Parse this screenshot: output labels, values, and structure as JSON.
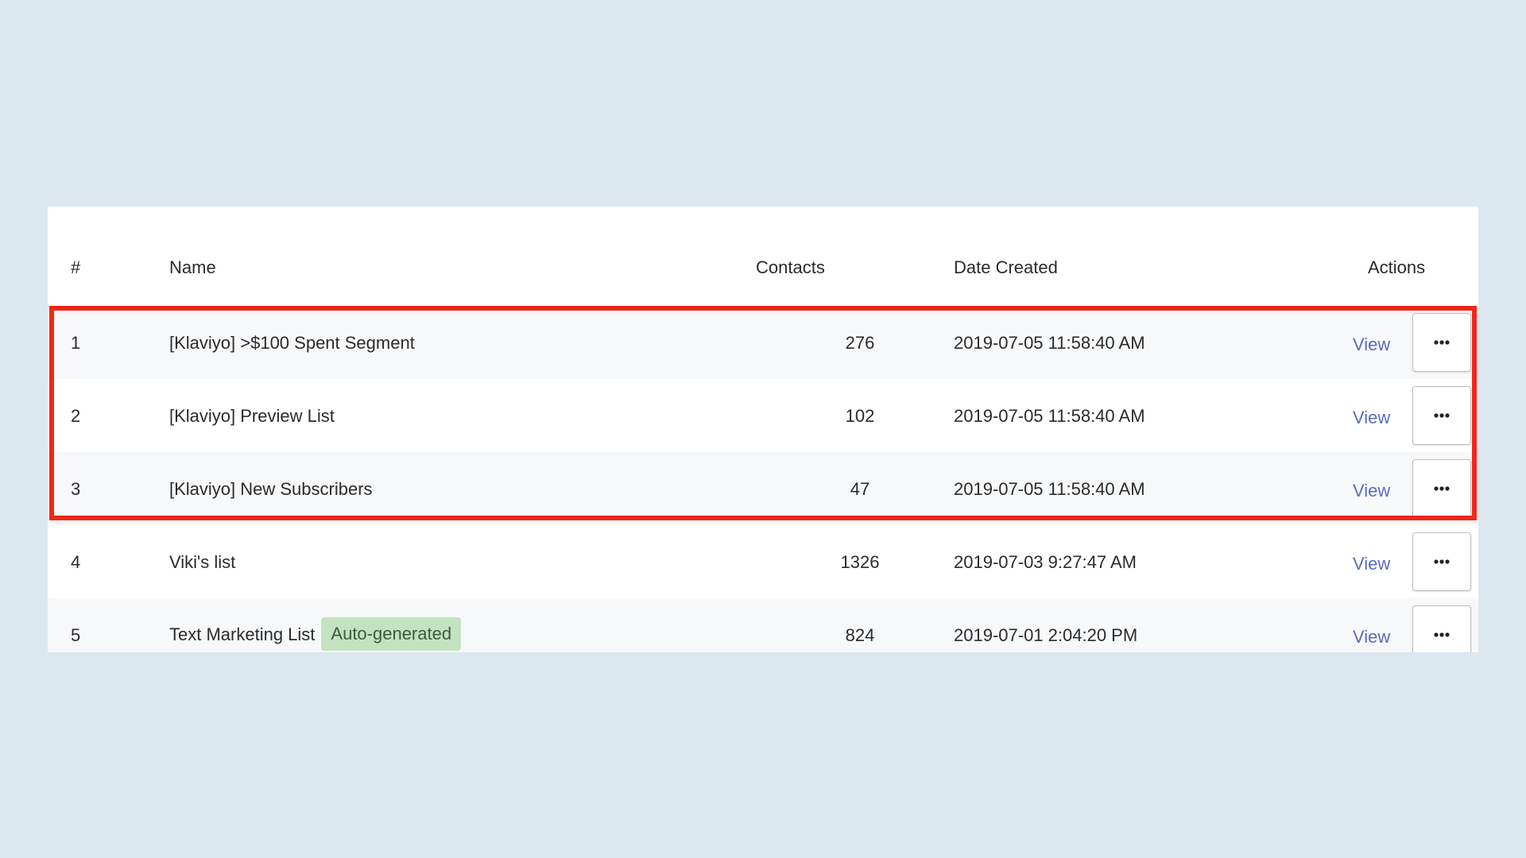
{
  "table": {
    "headers": {
      "num": "#",
      "name": "Name",
      "contacts": "Contacts",
      "date_created": "Date Created",
      "actions": "Actions"
    },
    "rows": [
      {
        "num": "1",
        "name": "[Klaviyo] >$100 Spent Segment",
        "contacts": "276",
        "date": "2019-07-05 11:58:40 AM",
        "view_label": "View",
        "more_icon": "ellipsis-icon",
        "badge": ""
      },
      {
        "num": "2",
        "name": "[Klaviyo] Preview List",
        "contacts": "102",
        "date": "2019-07-05 11:58:40 AM",
        "view_label": "View",
        "more_icon": "ellipsis-icon",
        "badge": ""
      },
      {
        "num": "3",
        "name": "[Klaviyo] New Subscribers",
        "contacts": "47",
        "date": "2019-07-05 11:58:40 AM",
        "view_label": "View",
        "more_icon": "ellipsis-icon",
        "badge": ""
      },
      {
        "num": "4",
        "name": "Viki's list",
        "contacts": "1326",
        "date": "2019-07-03 9:27:47 AM",
        "view_label": "View",
        "more_icon": "ellipsis-icon",
        "badge": ""
      },
      {
        "num": "5",
        "name": "Text Marketing List",
        "contacts": "824",
        "date": "2019-07-01 2:04:20 PM",
        "view_label": "View",
        "more_icon": "ellipsis-icon",
        "badge": "Auto-generated"
      }
    ]
  },
  "colors": {
    "background": "#dce8ef",
    "panel": "#ffffff",
    "row_alt": "#f7f8fa",
    "link": "#5b6bc0",
    "badge_bg": "#c3e3c0",
    "badge_text": "#3d5a3d",
    "highlight_border": "#f0271a"
  }
}
